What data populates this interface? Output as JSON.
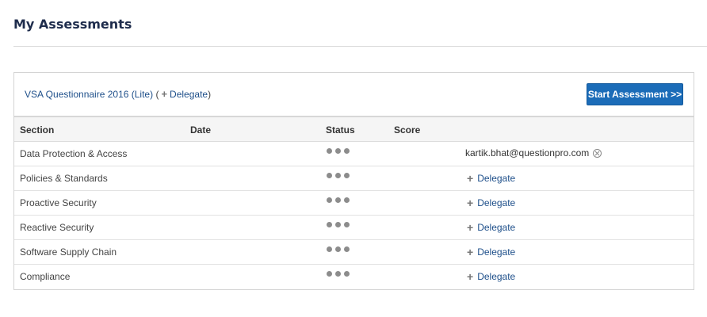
{
  "page": {
    "title": "My Assessments"
  },
  "assessment": {
    "questionnaire_name": "VSA Questionnaire 2016 (Lite)",
    "paren_open": "(",
    "delegate_label": "Delegate",
    "paren_close": ")",
    "start_button_label": "Start Assessment >>"
  },
  "table": {
    "headers": {
      "section": "Section",
      "date": "Date",
      "status": "Status",
      "score": "Score"
    },
    "rows": [
      {
        "section": "Data Protection & Access",
        "status": "in-progress",
        "assignee": "kartik.bhat@questionpro.com"
      },
      {
        "section": "Policies & Standards",
        "status": "in-progress",
        "action": "Delegate"
      },
      {
        "section": "Proactive Security",
        "status": "in-progress",
        "action": "Delegate"
      },
      {
        "section": "Reactive Security",
        "status": "in-progress",
        "action": "Delegate"
      },
      {
        "section": "Software Supply Chain",
        "status": "in-progress",
        "action": "Delegate"
      },
      {
        "section": "Compliance",
        "status": "in-progress",
        "action": "Delegate"
      }
    ]
  },
  "icons": {
    "status": "ellipsis-icon",
    "delegate": "plus-icon",
    "remove_assignee": "close-circle-icon"
  },
  "colors": {
    "primary_button": "#1b6cb8",
    "link": "#1e4f8a",
    "title": "#1f2d4d"
  }
}
